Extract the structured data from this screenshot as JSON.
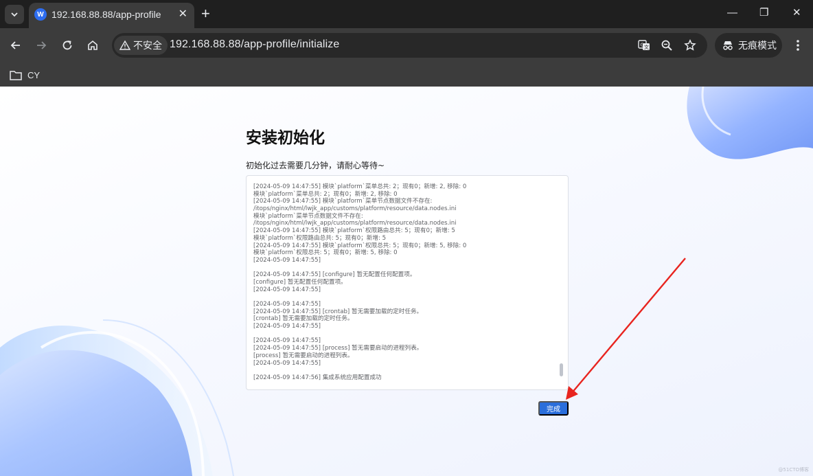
{
  "browser": {
    "tab": {
      "title": "192.168.88.88/app-profile",
      "close_glyph": "✕"
    },
    "new_tab_glyph": "+",
    "window_controls": {
      "minimize": "—",
      "restore": "❐",
      "close": "✕"
    },
    "address_bar": {
      "security_label": "不安全",
      "url": "192.168.88.88/app-profile/initialize"
    },
    "incognito_label": "无痕模式",
    "bookmarks": [
      {
        "label": "CY"
      }
    ]
  },
  "page": {
    "title": "安装初始化",
    "subtitle": "初始化过去需要几分钟，请耐心等待~",
    "log_lines": [
      "[2024-05-09 14:47:55] 模块`platform`菜单总共: 2；现有0；新增: 2, 移除: 0",
      "模块`platform`菜单总共: 2；现有0；新增: 2, 移除: 0",
      "[2024-05-09 14:47:55] 模块`platform`菜单节点数据文件不存在:",
      "/itops/nginx/html/lwjk_app/customs/platform/resource/data.nodes.ini",
      "模块`platform`菜单节点数据文件不存在:",
      "/itops/nginx/html/lwjk_app/customs/platform/resource/data.nodes.ini",
      "[2024-05-09 14:47:55] 模块`platform`权限路由总共: 5；现有0；新增: 5",
      "模块`platform`权限路由总共: 5；现有0；新增: 5",
      "[2024-05-09 14:47:55] 模块`platform`权限总共: 5；现有0；新增: 5, 移除: 0",
      "模块`platform`权限总共: 5；现有0；新增: 5, 移除: 0",
      "[2024-05-09 14:47:55]",
      "",
      "[2024-05-09 14:47:55] [configure] 暂无配置任何配置项。",
      "[configure] 暂无配置任何配置项。",
      "[2024-05-09 14:47:55]",
      "",
      "[2024-05-09 14:47:55]",
      "[2024-05-09 14:47:55] [crontab] 暂无需要加载的定时任务。",
      "[crontab] 暂无需要加载的定时任务。",
      "[2024-05-09 14:47:55]",
      "",
      "[2024-05-09 14:47:55]",
      "[2024-05-09 14:47:55] [process] 暂无需要启动的进程列表。",
      "[process] 暂无需要启动的进程列表。",
      "[2024-05-09 14:47:55]",
      "",
      "[2024-05-09 14:47:56] 集成系统应用配置成功"
    ],
    "done_button": "完成",
    "watermark": "@51CTO博客"
  },
  "colors": {
    "primary_button": "#2a6edb",
    "annotation_arrow": "#e8241f",
    "browser_dark": "#3c3c3c"
  },
  "icons": {
    "tab_search": "chevron-down-icon",
    "favicon": "app-logo-icon",
    "back": "arrow-left-icon",
    "forward": "arrow-right-icon",
    "reload": "reload-icon",
    "home": "home-icon",
    "security": "warning-triangle-icon",
    "translate": "translate-icon",
    "zoom": "zoom-icon",
    "bookmark_star": "star-icon",
    "incognito": "incognito-icon",
    "menu": "more-vertical-icon",
    "folder": "folder-icon"
  }
}
